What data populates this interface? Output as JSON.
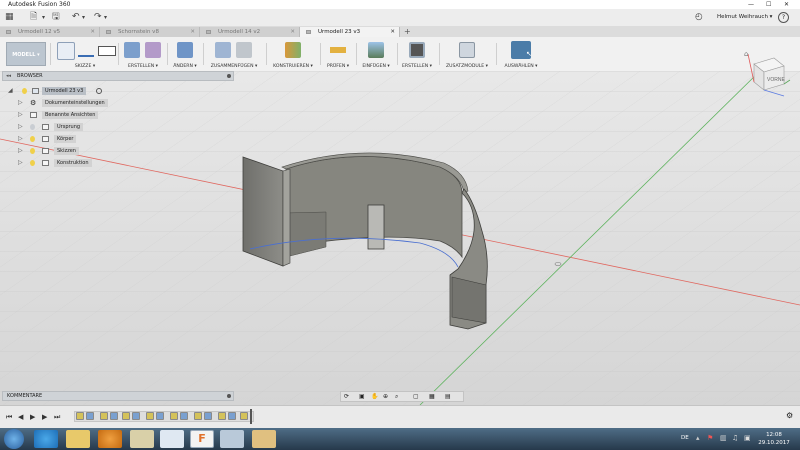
{
  "window": {
    "title": "Autodesk Fusion 360",
    "controls": [
      "minimize",
      "maximize",
      "close"
    ]
  },
  "quickbar": {
    "user_name": "Helmut Weihrauch ▾",
    "help_label": "?"
  },
  "tabs": [
    {
      "label": "Urmodell 12 v5",
      "active": false
    },
    {
      "label": "Schornstein v8",
      "active": false
    },
    {
      "label": "Urmodell 14 v2",
      "active": false
    },
    {
      "label": "Urmodell 23 v3",
      "active": true
    }
  ],
  "ribbon": {
    "workspace": "MODELL ▾",
    "groups": [
      "SKIZZE ▾",
      "ERSTELLEN ▾",
      "ÄNDERN ▾",
      "ZUSAMMENFÜGEN ▾",
      "KONSTRUIEREN ▾",
      "PRÜFEN ▾",
      "EINFÜGEN ▾",
      "ERSTELLEN ▾",
      "ZUSATZMODULE ▾",
      "AUSWÄHLEN ▾"
    ]
  },
  "browser": {
    "title": "BROWSER",
    "root": "Urmodell 23 v3",
    "items": [
      "Dokumenteinstellungen",
      "Benannte Ansichten",
      "Ursprung",
      "Körper",
      "Skizzen",
      "Konstruktion"
    ]
  },
  "comments": {
    "title": "KOMMENTARE"
  },
  "viewcube": {
    "face_label": "VORNE"
  },
  "taskbar": {
    "language": "DE",
    "time": "12:08",
    "date": "29.10.2017",
    "apps": [
      "start-orb",
      "internet-explorer",
      "file-explorer",
      "media-player",
      "photos",
      "notepad",
      "fusion-360",
      "image-editor",
      "paint"
    ]
  },
  "colors": {
    "accent": "#2b6cb0",
    "axis_red": "#e0675f",
    "axis_green": "#5fb35f",
    "model_gray": "#7b7b77"
  }
}
